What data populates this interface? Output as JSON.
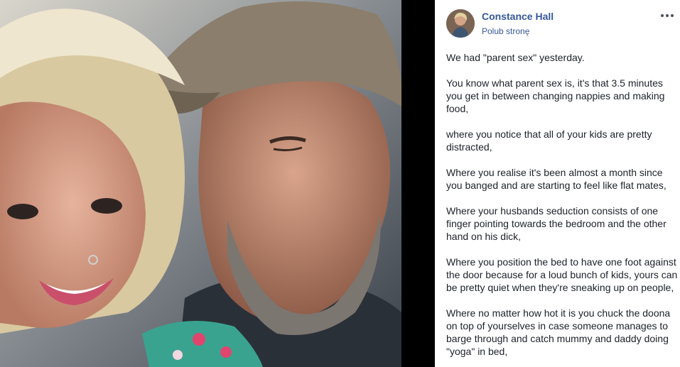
{
  "post": {
    "author": "Constance Hall",
    "like_page": "Polub stronę",
    "paragraphs": [
      "We had \"parent sex\" yesterday.",
      "You know what parent sex is, it's that 3.5 minutes you get in between changing nappies and making food,",
      "where you notice that all of your kids are pretty distracted,",
      "Where you realise it's been almost a month since you banged and are starting to feel like flat mates,",
      "Where your husbands seduction consists of one finger pointing towards the bedroom and the other hand on his dick,",
      "Where you position the bed to have one foot against the door because for a loud bunch of kids, yours can be pretty quiet when they're sneaking up on people,",
      "Where no matter how hot it is you chuck the doona on top of yourselves in case someone manages to barge through and catch mummy and daddy doing \"yoga\" in bed,"
    ]
  },
  "icons": {
    "more": "more-options-icon",
    "avatar": "profile-avatar"
  },
  "colors": {
    "link": "#365899",
    "text": "#1d2129",
    "pane_bg": "#ffffff",
    "backdrop": "#000000"
  }
}
